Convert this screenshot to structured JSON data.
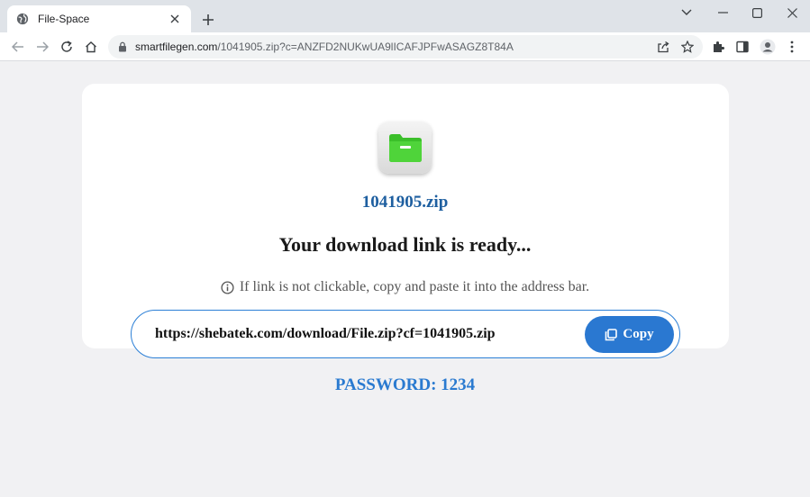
{
  "browser": {
    "tab_title": "File-Space",
    "url_host": "smartfilegen.com",
    "url_path": "/1041905.zip?c=ANZFD2NUKwUA9lICAFJPFwASAGZ8T84A"
  },
  "page": {
    "file_name": "1041905.zip",
    "headline": "Your download link is ready...",
    "hint": "If link is not clickable, copy and paste it into the address bar.",
    "download_link": "https://shebatek.com/download/File.zip?cf=1041905.zip",
    "copy_label": "Copy",
    "password": "PASSWORD: 1234"
  },
  "colors": {
    "accent": "#2a78d1",
    "file_name": "#1e5fa0",
    "folder": "#4fd43a"
  }
}
